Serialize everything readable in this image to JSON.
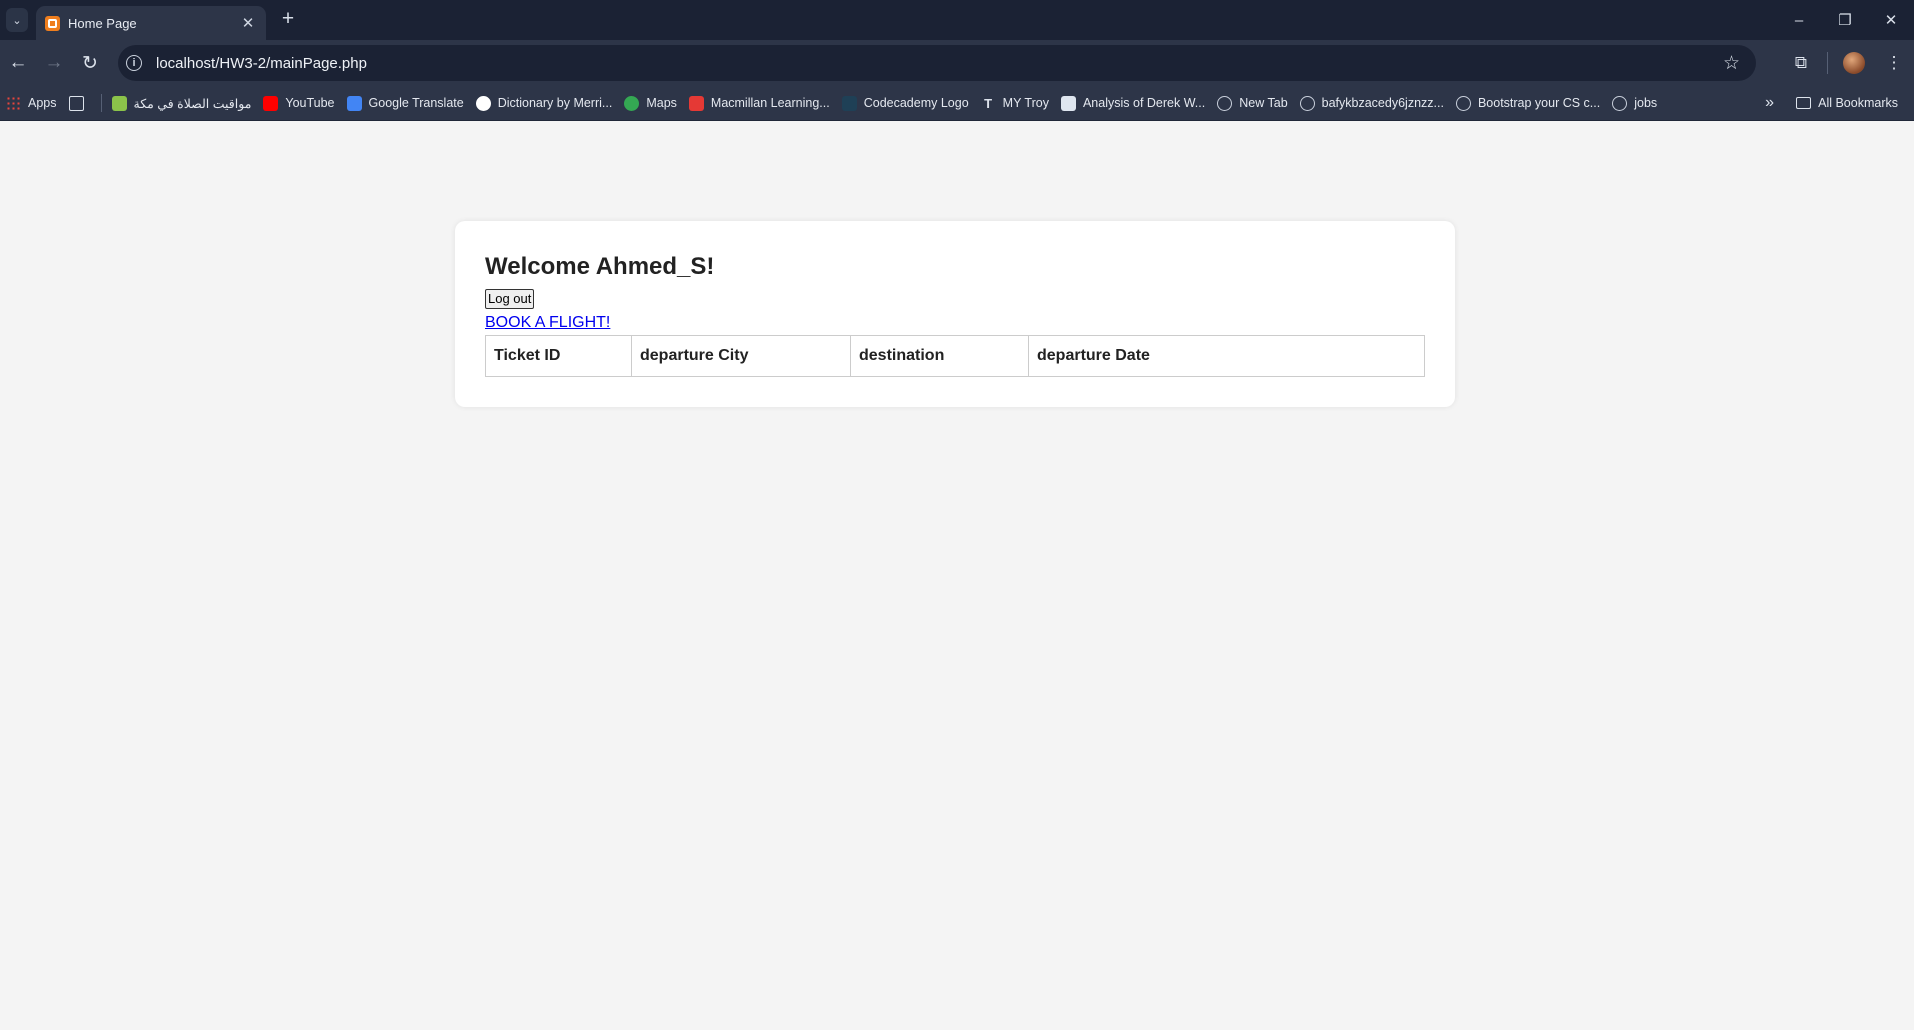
{
  "browser": {
    "tab_title": "Home Page",
    "url": "localhost/HW3-2/mainPage.php",
    "bookmarks": [
      {
        "label": "Apps",
        "icon": "apps-grid-icon",
        "color": "#e8453c"
      },
      {
        "label": "",
        "icon": "tab-groups-icon",
        "color": "#dde3ec"
      },
      {
        "label": "مواقيت الصلاة في مكة",
        "icon": "mosque-icon",
        "color": "#8bc34a"
      },
      {
        "label": "YouTube",
        "icon": "youtube-icon",
        "color": "#ff0000"
      },
      {
        "label": "Google Translate",
        "icon": "google-translate-icon",
        "color": "#4285f4"
      },
      {
        "label": "Dictionary by Merri...",
        "icon": "merriam-webster-icon",
        "color": "#ffffff"
      },
      {
        "label": "Maps",
        "icon": "maps-pin-icon",
        "color": "#34a853"
      },
      {
        "label": "Macmillan Learning...",
        "icon": "macmillan-icon",
        "color": "#e53935"
      },
      {
        "label": "Codecademy Logo",
        "icon": "codecademy-icon",
        "color": "#1f4056"
      },
      {
        "label": "MY Troy",
        "icon": "troy-t-icon",
        "color": "#dde3ec"
      },
      {
        "label": "Analysis of Derek W...",
        "icon": "document-icon",
        "color": "#dfe6f0"
      },
      {
        "label": "New Tab",
        "icon": "globe-icon",
        "color": "#c9d0dc"
      },
      {
        "label": "bafykbzacedy6jznzz...",
        "icon": "globe-icon",
        "color": "#c9d0dc"
      },
      {
        "label": "Bootstrap your CS c...",
        "icon": "globe-icon",
        "color": "#c9d0dc"
      },
      {
        "label": "jobs",
        "icon": "globe-icon",
        "color": "#c9d0dc"
      }
    ],
    "all_bookmarks": "All Bookmarks"
  },
  "page": {
    "welcome": "Welcome Ahmed_S!",
    "logout_label": "Log out",
    "book_link": "BOOK A FLIGHT!",
    "table_headers": [
      "Ticket ID",
      "departure City",
      "destination",
      "departure Date"
    ]
  }
}
